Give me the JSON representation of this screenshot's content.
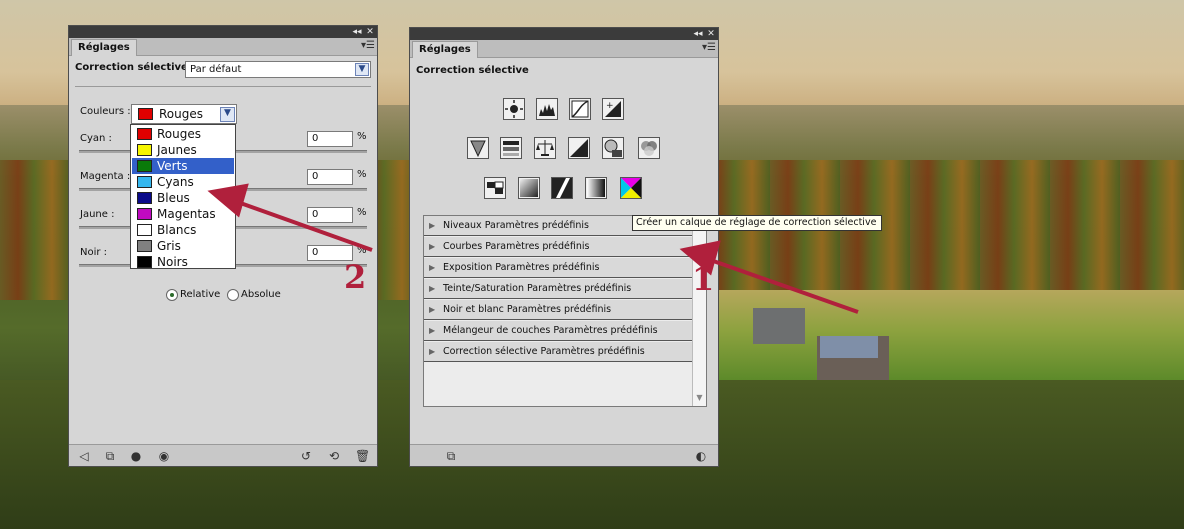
{
  "left_panel": {
    "tab": "Réglages",
    "header": "Correction sélective",
    "preset_value": "Par défaut",
    "colors_label": "Couleurs :",
    "colors_value": "Rouges",
    "colors_swatch": "#e00000",
    "sliders": [
      {
        "label": "Cyan :",
        "value": "0",
        "unit": "%"
      },
      {
        "label": "Magenta :",
        "value": "0",
        "unit": "%"
      },
      {
        "label": "Jaune :",
        "value": "0",
        "unit": "%"
      },
      {
        "label": "Noir :",
        "value": "0",
        "unit": "%"
      }
    ],
    "radio_relative": "Relative",
    "radio_absolute": "Absolue",
    "dropdown_options": [
      {
        "label": "Rouges",
        "swatch": "#e00000"
      },
      {
        "label": "Jaunes",
        "swatch": "#f5f500"
      },
      {
        "label": "Verts",
        "swatch": "#0a7a0a"
      },
      {
        "label": "Cyans",
        "swatch": "#34b7ef"
      },
      {
        "label": "Bleus",
        "swatch": "#0a0a8a"
      },
      {
        "label": "Magentas",
        "swatch": "#c00ac0"
      },
      {
        "label": "Blancs",
        "swatch": "#ffffff"
      },
      {
        "label": "Gris",
        "swatch": "#808080"
      },
      {
        "label": "Noirs",
        "swatch": "#000000"
      }
    ],
    "selected_option": "Verts",
    "footer_icons": [
      "back-arrow-icon",
      "clip-layer-icon",
      "mask-icon",
      "eye-icon",
      "refresh-icon",
      "reset-icon",
      "trash-icon"
    ]
  },
  "right_panel": {
    "tab": "Réglages",
    "header": "Correction sélective",
    "tool_rows": [
      [
        "brightness-icon",
        "levels-icon",
        "curves-icon",
        "exposure-icon"
      ],
      [
        "vibrance-icon",
        "hue-saturation-icon",
        "color-balance-icon",
        "black-white-icon",
        "photo-filter-icon",
        "channel-mixer-icon"
      ],
      [
        "invert-icon",
        "posterize-icon",
        "threshold-icon",
        "gradient-map-icon",
        "selective-color-icon"
      ]
    ],
    "presets": [
      "Niveaux Paramètres prédéfinis",
      "Courbes Paramètres prédéfinis",
      "Exposition Paramètres prédéfinis",
      "Teinte/Saturation Paramètres prédéfinis",
      "Noir et blanc Paramètres prédéfinis",
      "Mélangeur de couches Paramètres prédéfinis",
      "Correction sélective Paramètres prédéfinis"
    ],
    "tooltip": "Créer un calque de réglage de correction sélective"
  },
  "annotations": {
    "one": "1",
    "two": "2"
  },
  "colors": {
    "arrow": "#b0203c",
    "selection": "#3360c9"
  }
}
